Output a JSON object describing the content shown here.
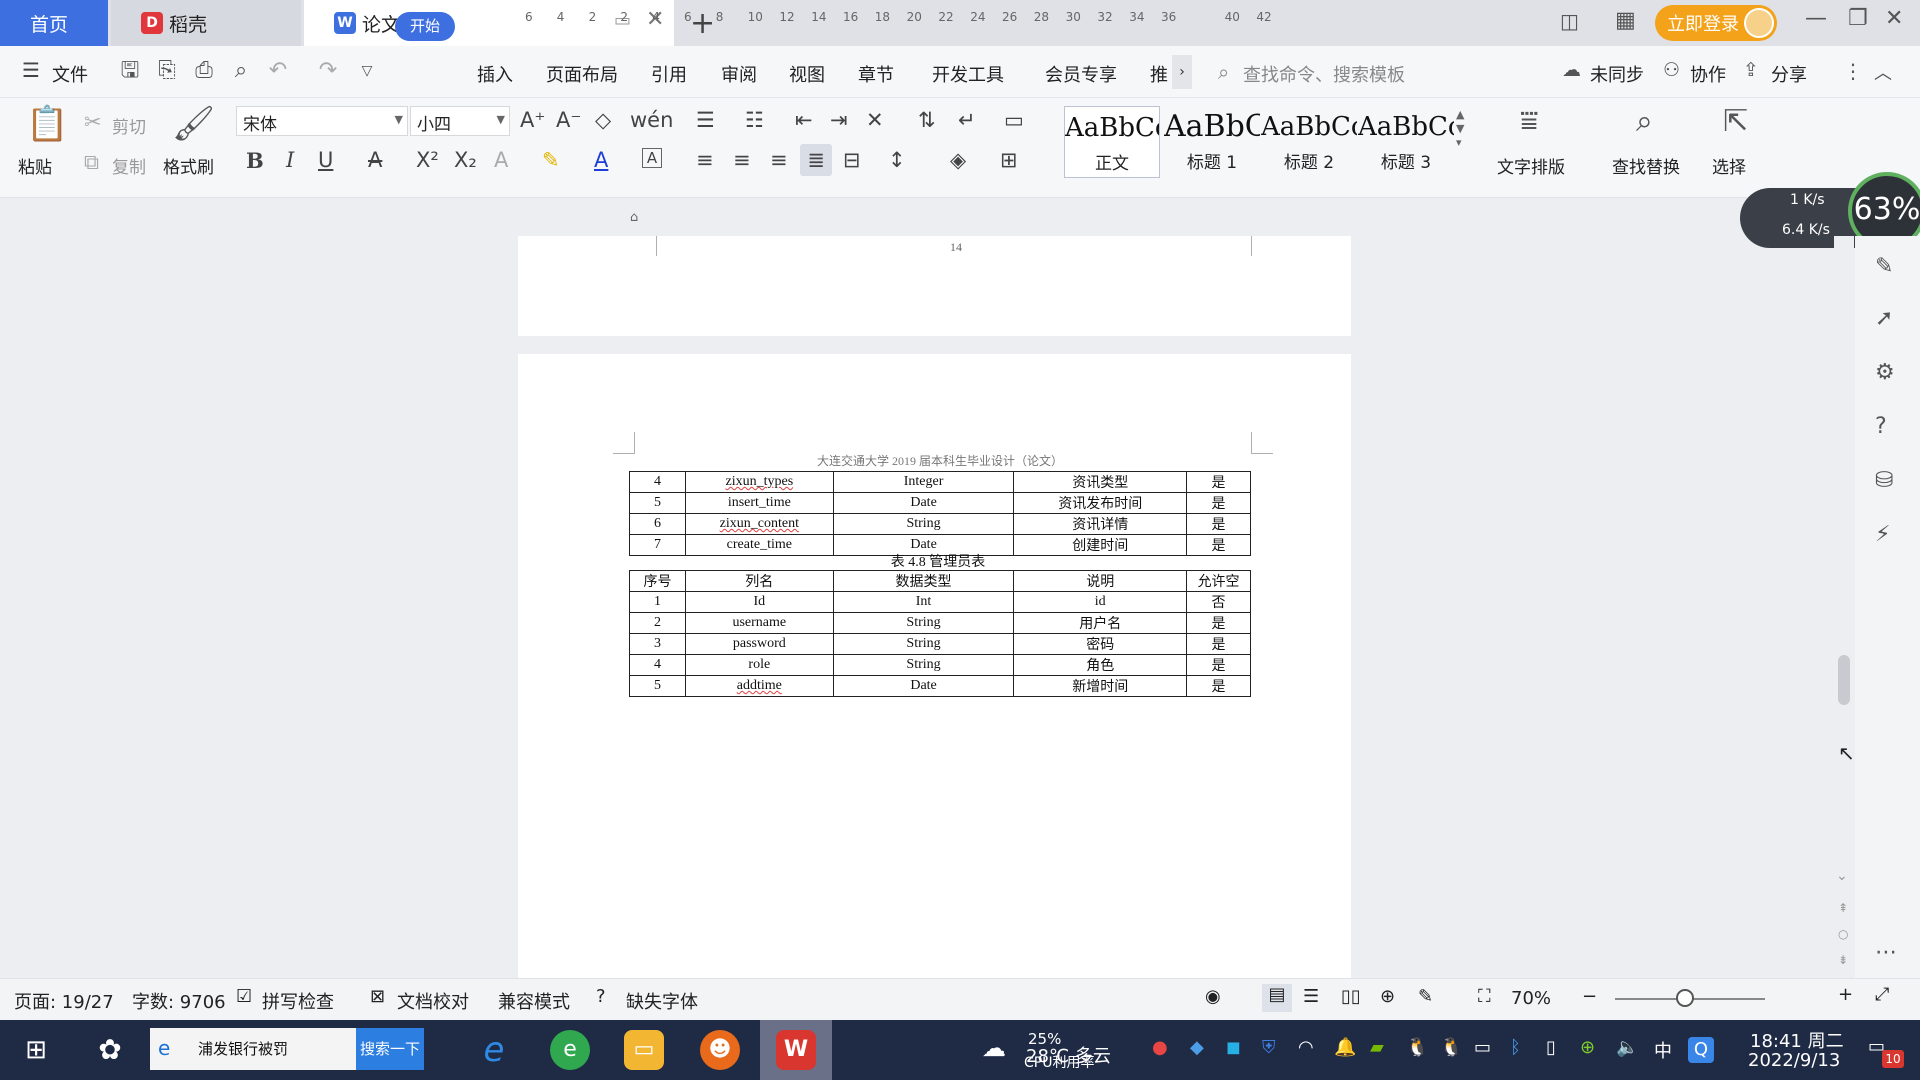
{
  "tabs": [
    {
      "label": "首页"
    },
    {
      "label": "稻壳"
    },
    {
      "label": "论文.doc"
    }
  ],
  "title_bar": {
    "login_label": "立即登录"
  },
  "menu": {
    "file": "文件",
    "items": [
      "开始",
      "插入",
      "页面布局",
      "引用",
      "审阅",
      "视图",
      "章节",
      "开发工具",
      "会员专享",
      "推"
    ],
    "search_placeholder": "查找命令、搜索模板",
    "unsynced": "未同步",
    "collab": "协作",
    "share": "分享"
  },
  "ribbon": {
    "paste": "粘贴",
    "cut": "剪切",
    "copy": "复制",
    "format_painter": "格式刷",
    "font_name": "宋体",
    "font_size": "小四",
    "styles": [
      {
        "sample": "AaBbCcI",
        "name": "正文"
      },
      {
        "sample": "AaBbC",
        "name": "标题 1"
      },
      {
        "sample": "AaBbCc",
        "name": "标题 2"
      },
      {
        "sample": "AaBbCc",
        "name": "标题 3"
      }
    ],
    "text_layout": "文字排版",
    "find_replace": "查找替换",
    "select": "选择"
  },
  "ruler": {
    "ticks": [
      "6",
      "4",
      "2",
      "2",
      "4",
      "6",
      "8",
      "10",
      "12",
      "14",
      "16",
      "18",
      "20",
      "22",
      "24",
      "26",
      "28",
      "30",
      "32",
      "34",
      "36",
      "40",
      "42"
    ]
  },
  "network": {
    "up": "1 K/s",
    "down": "6.4 K/s",
    "percent": "63%"
  },
  "document": {
    "page_number_prev": "14",
    "header": "大连交通大学 2019 届本科生毕业设计（论文）",
    "table1_rows": [
      [
        "4",
        "zixun_types",
        "Integer",
        "资讯类型",
        "是"
      ],
      [
        "5",
        "insert_time",
        "Date",
        "资讯发布时间",
        "是"
      ],
      [
        "6",
        "zixun_content",
        "String",
        "资讯详情",
        "是"
      ],
      [
        "7",
        "create_time",
        "Date",
        "创建时间",
        "是"
      ]
    ],
    "caption": "表 4.8 管理员表",
    "table2_header": [
      "序号",
      "列名",
      "数据类型",
      "说明",
      "允许空"
    ],
    "table2_rows": [
      [
        "1",
        "Id",
        "Int",
        "id",
        "否"
      ],
      [
        "2",
        "username",
        "String",
        "用户名",
        "是"
      ],
      [
        "3",
        "password",
        "String",
        "密码",
        "是"
      ],
      [
        "4",
        "role",
        "String",
        "角色",
        "是"
      ],
      [
        "5",
        "addtime",
        "Date",
        "新增时间",
        "是"
      ]
    ]
  },
  "status": {
    "page": "页面: 19/27",
    "words": "字数: 9706",
    "spellcheck": "拼写检查",
    "doc_proof": "文档校对",
    "compat": "兼容模式",
    "missing_font": "缺失字体",
    "zoom": "70%"
  },
  "taskbar": {
    "search_text": "浦发银行被罚",
    "search_button": "搜索一下",
    "weather": "28℃ 多云",
    "cpu": "25%",
    "cpu_label": "CPU利用率",
    "ime": "中",
    "time": "18:41 周二",
    "date": "2022/9/13",
    "notif_count": "10"
  }
}
